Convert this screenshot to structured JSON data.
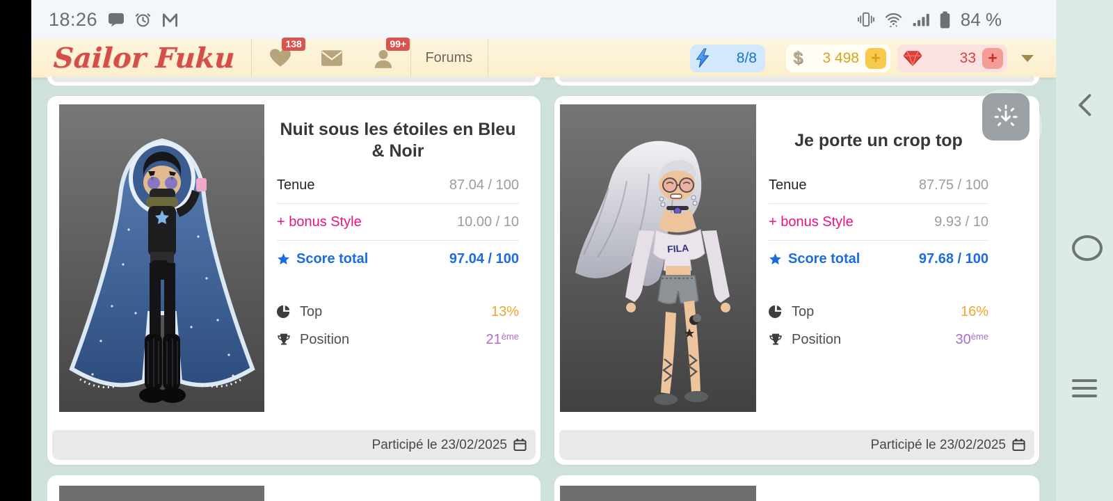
{
  "status_bar": {
    "time": "18:26",
    "battery": "84 %"
  },
  "header": {
    "logo": "Sailor Fuku",
    "likes_badge": "138",
    "friends_badge": "99+",
    "forums_label": "Forums",
    "energy_value": "8/8",
    "coins_value": "3 498",
    "coins_add_label": "+",
    "gems_value": "33",
    "gems_add_label": "+"
  },
  "labels": {
    "tenue": "Tenue",
    "bonus_style": "+ bonus Style",
    "score_total": "Score total",
    "top": "Top",
    "position": "Position"
  },
  "cards": [
    {
      "title": "Nuit sous les étoiles en Bleu & Noir",
      "tenue_score": "87.04 / 100",
      "bonus_score": "10.00 / 10",
      "total_score": "97.04 / 100",
      "top_percent": "13%",
      "position_value": "21",
      "position_suffix": "ème",
      "participation_date": "Participé le 23/02/2025"
    },
    {
      "title": "Je porte un crop top",
      "tenue_score": "87.75 / 100",
      "bonus_score": "9.93 / 10",
      "total_score": "97.68 / 100",
      "top_percent": "16%",
      "position_value": "30",
      "position_suffix": "ème",
      "participation_date": "Participé le 23/02/2025",
      "avatar_shirt_text": "FILA"
    }
  ],
  "colors": {
    "page_background": "#cfe2d9",
    "nav_strip": "#dcebe3",
    "header_cream": "#fdf3da",
    "logo_red": "#d44f4a",
    "badge_red": "#d9534f",
    "icon_tan": "#b5a47c",
    "energy_blue": "#1a74c9",
    "coin_gold": "#d8a41f",
    "gem_red": "#d2413c",
    "accent_pink": "#e8157f",
    "accent_blue": "#1b6ce0",
    "accent_orange": "#f4a32f",
    "accent_purple": "#ad6cc9",
    "footer_gray": "#e9e9e9"
  }
}
